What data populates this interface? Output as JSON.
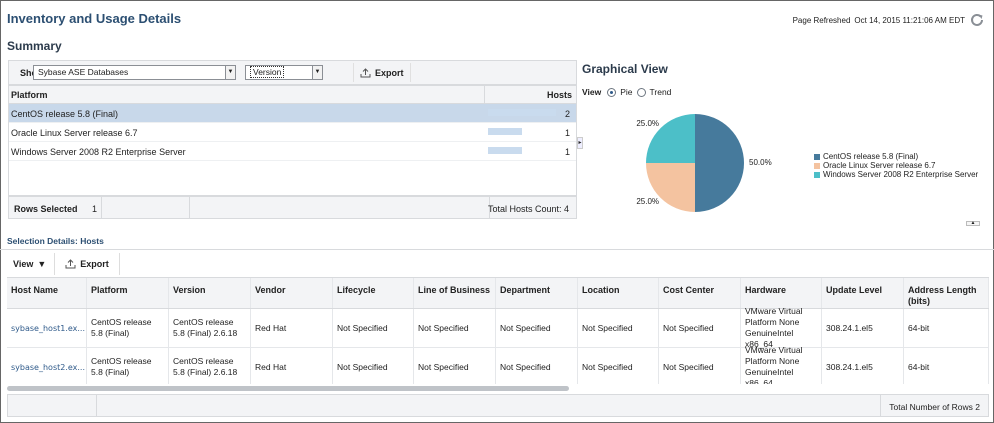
{
  "header": {
    "title": "Inventory and Usage Details",
    "refresh_label": "Page Refreshed",
    "refresh_time": "Oct 14, 2015 11:21:06 AM EDT"
  },
  "summary": {
    "title": "Summary",
    "show_label": "Show",
    "show_value": "Sybase ASE Databases",
    "group_value": "Version",
    "export_label": "Export",
    "columns": [
      "Platform",
      "Hosts"
    ],
    "rows": [
      {
        "platform": "CentOS release 5.8 (Final)",
        "hosts": "2",
        "fraction": 1.0
      },
      {
        "platform": "Oracle Linux Server release 6.7",
        "hosts": "1",
        "fraction": 0.5
      },
      {
        "platform": "Windows Server 2008 R2 Enterprise Server",
        "hosts": "1",
        "fraction": 0.5
      }
    ],
    "rows_selected_label": "Rows Selected",
    "rows_selected_value": "1",
    "total_hosts": "Total Hosts Count: 4"
  },
  "graph": {
    "title": "Graphical View",
    "view_label": "View",
    "option_pie": "Pie",
    "option_trend": "Trend",
    "selected": "Pie"
  },
  "chart_data": {
    "type": "pie",
    "categories": [
      "CentOS release 5.8 (Final)",
      "Oracle Linux Server release 6.7",
      "Windows Server 2008 R2 Enterprise Server"
    ],
    "values": [
      50.0,
      25.0,
      25.0
    ],
    "labels": [
      "50.0%",
      "25.0%",
      "25.0%"
    ],
    "colors": [
      "#467a9c",
      "#f4c3a0",
      "#4cbfc8"
    ],
    "legend": "right"
  },
  "details": {
    "title": "Selection Details: Hosts",
    "view_label": "View",
    "export_label": "Export",
    "columns": [
      "Host Name",
      "Platform",
      "Version",
      "Vendor",
      "Lifecycle",
      "Line of Business",
      "Department",
      "Location",
      "Cost Center",
      "Hardware",
      "Update Level",
      "Address Length (bits)"
    ],
    "rows": [
      [
        "sybase_host1.ex...",
        "CentOS release 5.8 (Final)",
        "CentOS release 5.8 (Final) 2.6.18",
        "Red Hat",
        "Not Specified",
        "Not Specified",
        "Not Specified",
        "Not Specified",
        "Not Specified",
        "VMware Virtual Platform None GenuineIntel x86_64",
        "308.24.1.el5",
        "64-bit"
      ],
      [
        "sybase_host2.ex...",
        "CentOS release 5.8 (Final)",
        "CentOS release 5.8 (Final) 2.6.18",
        "Red Hat",
        "Not Specified",
        "Not Specified",
        "Not Specified",
        "Not Specified",
        "Not Specified",
        "VMware Virtual Platform None GenuineIntel x86_64",
        "308.24.1.el5",
        "64-bit"
      ]
    ],
    "total_rows": "Total Number of Rows 2"
  }
}
